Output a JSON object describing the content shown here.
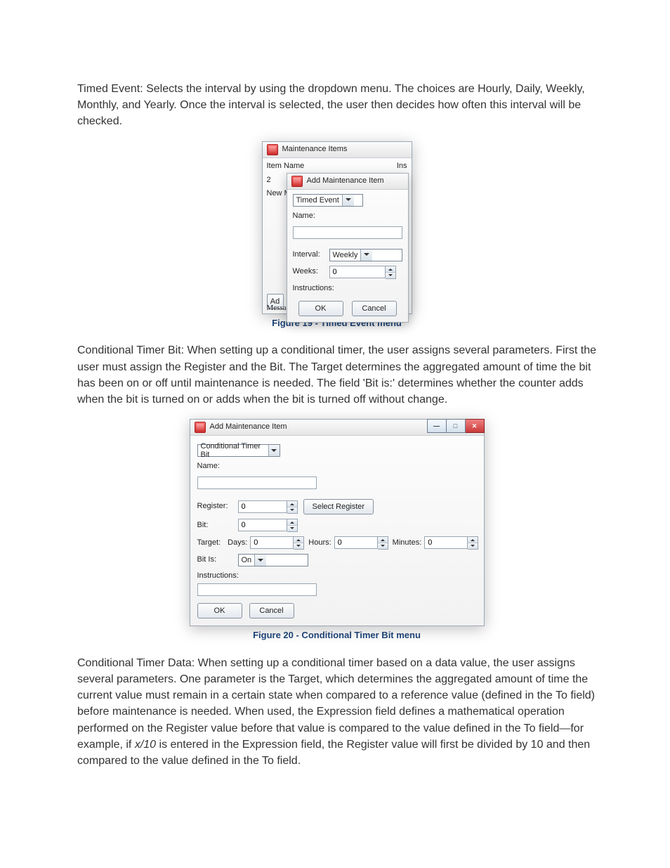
{
  "paragraphs": {
    "p1": "Timed Event:  Selects the interval by using the dropdown menu.  The choices are Hourly, Daily, Weekly, Monthly, and Yearly.  Once the interval is selected, the user then decides how often this interval will be checked.",
    "p2": "Conditional Timer Bit: When setting up a conditional timer, the user assigns several parameters. First the user must assign the Register and the Bit. The Target determines the aggregated amount of time the bit has been on or off until maintenance is needed. The field 'Bit is:' determines whether the counter adds when the bit is turned on or adds when the bit is turned off without change.",
    "p3a": "Conditional Timer Data:  When setting up a conditional timer based on a data value, the user assigns several parameters. One parameter is the Target, which determines the aggregated amount of time the current value must remain in a certain state when compared to a reference value (defined in the To field) before maintenance is needed. When used, the Expression field defines a mathematical operation performed on the Register value before that value is compared to the value defined in the To field—for example, if ",
    "p3_expr": "x/10",
    "p3b": " is entered in the Expression field, the Register value will first be divided by 10 and then compared to the value defined in the To field."
  },
  "fig19": {
    "caption": "Figure 19 - Timed Event menu",
    "outer": {
      "title": "Maintenance Items",
      "col_item_name": "Item Name",
      "col_ins": "Ins",
      "row0": "2",
      "row1_partial": "New M",
      "add_button_partial": "Ad",
      "messages_partial": "Messa"
    },
    "inner": {
      "title": "Add Maintenance Item",
      "mode": "Timed Event",
      "name_label": "Name:",
      "name_value": "",
      "interval_label": "Interval:",
      "interval_value": "Weekly",
      "weeks_label": "Weeks:",
      "weeks_value": "0",
      "instructions_label": "Instructions:",
      "ok": "OK",
      "cancel": "Cancel"
    }
  },
  "fig20": {
    "caption": "Figure 20 - Conditional Timer Bit menu",
    "title": "Add Maintenance Item",
    "mode": "Conditional Timer Bit",
    "name_label": "Name:",
    "name_value": "",
    "register_label": "Register:",
    "register_value": "0",
    "select_register": "Select Register",
    "bit_label": "Bit:",
    "bit_value": "0",
    "target_label": "Target:",
    "days_label": "Days:",
    "days_value": "0",
    "hours_label": "Hours:",
    "hours_value": "0",
    "minutes_label": "Minutes:",
    "minutes_value": "0",
    "bitis_label": "Bit Is:",
    "bitis_value": "On",
    "instructions_label": "Instructions:",
    "instructions_value": "",
    "ok": "OK",
    "cancel": "Cancel"
  }
}
